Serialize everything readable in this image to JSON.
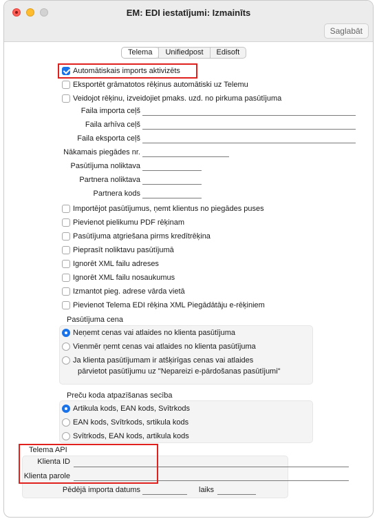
{
  "window": {
    "title": "EM: EDI iestatījumi: Izmainīts",
    "save_label": "Saglabāt"
  },
  "tabs": [
    "Telema",
    "Unifiedpost",
    "Edisoft"
  ],
  "top_checks": [
    {
      "label": "Automātiskais imports aktivizēts",
      "checked": true
    },
    {
      "label": "Eksportēt grāmatotos rēķinus automātiski uz Telemu",
      "checked": false
    },
    {
      "label": "Veidojot rēķinu, izveidojiet pmaks. uzd. no pirkuma pasūtījuma",
      "checked": false
    }
  ],
  "paths": {
    "import_label": "Faila importa ceļš",
    "archive_label": "Faila arhīva ceļš",
    "export_label": "Faila eksporta ceļš"
  },
  "fields": {
    "next_delivery_label": "Nākamais piegādes nr.",
    "order_warehouse_label": "Pasūtījuma noliktava",
    "partner_warehouse_label": "Partnera noliktava",
    "partner_code_label": "Partnera kods"
  },
  "options": [
    {
      "label": "Importējot pasūtījumus, ņemt klientus no piegādes puses",
      "checked": false
    },
    {
      "label": "Pievienot pielikumu PDF rēķinam",
      "checked": false
    },
    {
      "label": "Pasūtījuma atgriešana pirms kredītrēķina",
      "checked": false
    },
    {
      "label": "Pieprasīt noliktavu pasūtījumā",
      "checked": false
    },
    {
      "label": "Ignorēt XML failu adreses",
      "checked": false
    },
    {
      "label": "Ignorēt XML failu nosaukumus",
      "checked": false
    },
    {
      "label": "Izmantot pieg. adrese vārda vietā",
      "checked": false
    },
    {
      "label": "Pievienot Telema EDI rēķina XML Piegādātāju e-rēķiniem",
      "checked": false
    }
  ],
  "price_group": {
    "title": "Pasūtījuma cena",
    "radios": [
      {
        "label": "Neņemt cenas vai atlaides no klienta pasūtījuma",
        "checked": true
      },
      {
        "label": "Vienmēr ņemt cenas vai atlaides no klienta pasūtījuma",
        "checked": false
      },
      {
        "label": "Ja klienta pasūtījumam ir atšķirīgas cenas vai atlaides",
        "label2": "pārvietot pasūtījumu uz \"Nepareizi e-pārdošanas pasūtījumi\"",
        "checked": false
      }
    ]
  },
  "code_group": {
    "title": "Preču koda atpazīšanas secība",
    "radios": [
      {
        "label": "Artikula kods, EAN kods, Svītrkods",
        "checked": true
      },
      {
        "label": "EAN kods, Svītrkods, srtikula kods",
        "checked": false
      },
      {
        "label": "Svītrkods, EAN kods, artikula kods",
        "checked": false
      }
    ]
  },
  "api": {
    "title": "Telema API",
    "client_id_label": "Klienta ID",
    "client_password_label": "Klienta parole",
    "last_import_label": "Pēdējā importa datums",
    "time_label": "laiks"
  }
}
